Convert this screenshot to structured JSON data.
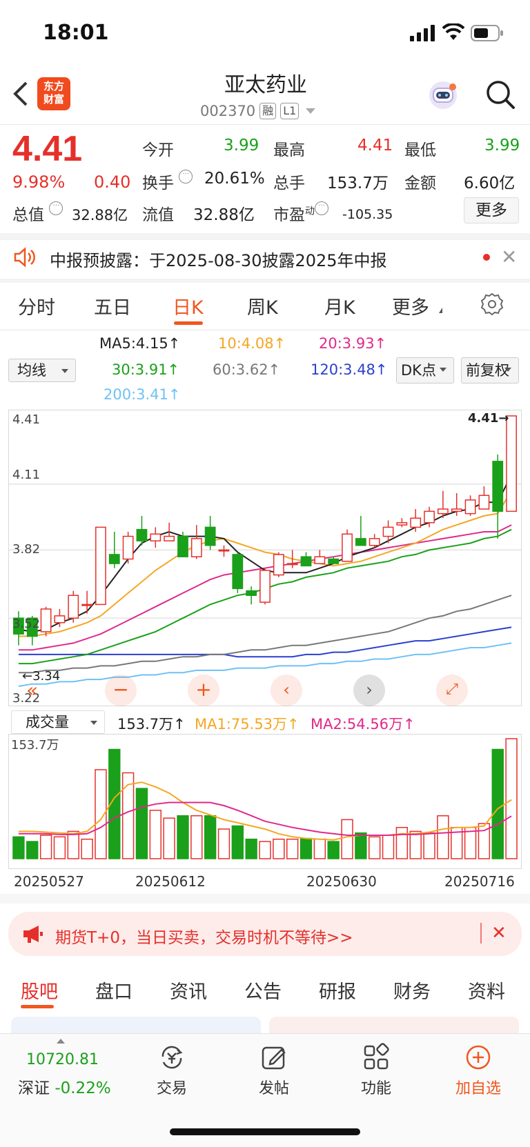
{
  "status": {
    "time": "18:01"
  },
  "header": {
    "name": "亚太药业",
    "code": "002370",
    "tag_rong": "融",
    "tag_l1": "L1",
    "logo_line1": "东方",
    "logo_line2": "财富"
  },
  "quote": {
    "price": "4.41",
    "pct": "9.98%",
    "change": "0.40",
    "open_label": "今开",
    "open": "3.99",
    "high_label": "最高",
    "high": "4.41",
    "low_label": "最低",
    "low": "3.99",
    "turnover_label": "换手",
    "turnover": "20.61%",
    "volume_label": "总手",
    "volume": "153.7万",
    "amount_label": "金额",
    "amount": "6.60亿",
    "mktcap_label": "总值",
    "mktcap": "32.88亿",
    "float_label": "流值",
    "float": "32.88亿",
    "pe_label": "市盈",
    "pe_sup": "动",
    "pe": "-105.35",
    "more": "更多"
  },
  "notice": {
    "text": "中报预披露：于2025-08-30披露2025年中报"
  },
  "ktabs": [
    "分时",
    "五日",
    "日K",
    "周K",
    "月K",
    "更多"
  ],
  "ma_legend": {
    "selector": "均线",
    "ma5": "MA5:4.15↑",
    "ma10": "10:4.08↑",
    "ma20": "20:3.93↑",
    "ma30": "30:3.91↑",
    "ma60": "60:3.62↑",
    "ma120": "120:3.48↑",
    "ma200": "200:3.41↑",
    "dk": "DK点",
    "fq": "前复权",
    "colors": {
      "ma5": "#222222",
      "ma10": "#f5a623",
      "ma20": "#e0298a",
      "ma30": "#1aa01a",
      "ma60": "#777777",
      "ma120": "#2a3fd0",
      "ma200": "#6ec1f5"
    }
  },
  "chart_axis": {
    "y_top": "4.41",
    "y2": "4.11",
    "y3": "3.82",
    "y4": "3.52",
    "y_bottom": "3.22",
    "last_price_tag": "4.41→",
    "low_tag": "←3.34"
  },
  "volume_legend": {
    "selector": "成交量",
    "vol": "153.7万↑",
    "ma1": "MA1:75.53万↑",
    "ma2": "MA2:54.56万↑",
    "max": "153.7万"
  },
  "dates": [
    "20250527",
    "20250612",
    "20250630",
    "20250716"
  ],
  "ad": {
    "text": "期货T+0，当日买卖，交易时机不等待>>"
  },
  "bottom_tabs": [
    "股吧",
    "盘口",
    "资讯",
    "公告",
    "研报",
    "财务",
    "资料"
  ],
  "index": {
    "value": "10720.81",
    "name": "深证",
    "pct": "-0.22%"
  },
  "nav": [
    "交易",
    "发帖",
    "功能",
    "加自选"
  ],
  "chart_data": {
    "type": "candlestick",
    "ylim": [
      3.22,
      4.41
    ],
    "up_color": "#e5302a",
    "down_color": "#1aa01a",
    "candles": [
      {
        "o": 3.52,
        "c": 3.45,
        "h": 3.55,
        "l": 3.4
      },
      {
        "o": 3.52,
        "c": 3.44,
        "h": 3.53,
        "l": 3.4
      },
      {
        "o": 3.46,
        "c": 3.56,
        "h": 3.57,
        "l": 3.44
      },
      {
        "o": 3.5,
        "c": 3.53,
        "h": 3.56,
        "l": 3.48
      },
      {
        "o": 3.52,
        "c": 3.62,
        "h": 3.64,
        "l": 3.5
      },
      {
        "o": 3.58,
        "c": 3.58,
        "h": 3.64,
        "l": 3.54
      },
      {
        "o": 3.58,
        "c": 3.92,
        "h": 3.92,
        "l": 3.58
      },
      {
        "o": 3.8,
        "c": 3.76,
        "h": 3.9,
        "l": 3.74
      },
      {
        "o": 3.78,
        "c": 3.88,
        "h": 3.9,
        "l": 3.76
      },
      {
        "o": 3.91,
        "c": 3.86,
        "h": 3.97,
        "l": 3.84
      },
      {
        "o": 3.86,
        "c": 3.89,
        "h": 3.92,
        "l": 3.83
      },
      {
        "o": 3.86,
        "c": 3.88,
        "h": 3.94,
        "l": 3.86
      },
      {
        "o": 3.88,
        "c": 3.79,
        "h": 3.9,
        "l": 3.79
      },
      {
        "o": 3.79,
        "c": 3.87,
        "h": 3.93,
        "l": 3.78
      },
      {
        "o": 3.92,
        "c": 3.84,
        "h": 3.97,
        "l": 3.82
      },
      {
        "o": 3.82,
        "c": 3.82,
        "h": 3.84,
        "l": 3.79
      },
      {
        "o": 3.8,
        "c": 3.65,
        "h": 3.81,
        "l": 3.63
      },
      {
        "o": 3.64,
        "c": 3.62,
        "h": 3.66,
        "l": 3.58
      },
      {
        "o": 3.59,
        "c": 3.73,
        "h": 3.74,
        "l": 3.58
      },
      {
        "o": 3.71,
        "c": 3.8,
        "h": 3.81,
        "l": 3.7
      },
      {
        "o": 3.76,
        "c": 3.76,
        "h": 3.82,
        "l": 3.74
      },
      {
        "o": 3.79,
        "c": 3.75,
        "h": 3.81,
        "l": 3.75
      },
      {
        "o": 3.76,
        "c": 3.79,
        "h": 3.82,
        "l": 3.76
      },
      {
        "o": 3.78,
        "c": 3.76,
        "h": 3.79,
        "l": 3.76
      },
      {
        "o": 3.77,
        "c": 3.89,
        "h": 3.91,
        "l": 3.77
      },
      {
        "o": 3.87,
        "c": 3.84,
        "h": 3.97,
        "l": 3.84
      },
      {
        "o": 3.84,
        "c": 3.87,
        "h": 3.89,
        "l": 3.83
      },
      {
        "o": 3.88,
        "c": 3.92,
        "h": 3.95,
        "l": 3.85
      },
      {
        "o": 3.93,
        "c": 3.94,
        "h": 3.96,
        "l": 3.92
      },
      {
        "o": 3.92,
        "c": 3.96,
        "h": 4.0,
        "l": 3.9
      },
      {
        "o": 3.94,
        "c": 3.99,
        "h": 4.01,
        "l": 3.92
      },
      {
        "o": 3.98,
        "c": 4.0,
        "h": 4.08,
        "l": 3.96
      },
      {
        "o": 3.99,
        "c": 4.0,
        "h": 4.07,
        "l": 3.97
      },
      {
        "o": 3.98,
        "c": 4.04,
        "h": 4.06,
        "l": 3.97
      },
      {
        "o": 4.0,
        "c": 4.06,
        "h": 4.1,
        "l": 4.0
      },
      {
        "o": 4.21,
        "c": 3.99,
        "h": 4.24,
        "l": 3.87
      },
      {
        "o": 3.99,
        "c": 4.41,
        "h": 4.41,
        "l": 3.99
      }
    ],
    "ma5": [
      3.47,
      3.46,
      3.47,
      3.5,
      3.52,
      3.55,
      3.62,
      3.7,
      3.78,
      3.85,
      3.88,
      3.9,
      3.88,
      3.88,
      3.88,
      3.87,
      3.81,
      3.77,
      3.73,
      3.72,
      3.72,
      3.72,
      3.74,
      3.76,
      3.79,
      3.81,
      3.83,
      3.86,
      3.89,
      3.92,
      3.94,
      3.97,
      3.99,
      4.0,
      4.03,
      4.03,
      4.15
    ],
    "ma10": [
      3.44,
      3.44,
      3.45,
      3.46,
      3.48,
      3.5,
      3.53,
      3.58,
      3.63,
      3.68,
      3.73,
      3.77,
      3.81,
      3.84,
      3.86,
      3.87,
      3.85,
      3.83,
      3.81,
      3.8,
      3.78,
      3.77,
      3.76,
      3.75,
      3.76,
      3.77,
      3.79,
      3.81,
      3.83,
      3.85,
      3.88,
      3.91,
      3.93,
      3.95,
      3.97,
      3.98,
      4.08
    ],
    "ma20": [
      3.38,
      3.38,
      3.39,
      3.4,
      3.41,
      3.43,
      3.45,
      3.48,
      3.51,
      3.54,
      3.57,
      3.6,
      3.63,
      3.66,
      3.69,
      3.71,
      3.72,
      3.73,
      3.74,
      3.75,
      3.76,
      3.77,
      3.78,
      3.79,
      3.8,
      3.81,
      3.82,
      3.83,
      3.84,
      3.85,
      3.86,
      3.87,
      3.88,
      3.89,
      3.9,
      3.9,
      3.93
    ],
    "ma30": [
      3.32,
      3.32,
      3.33,
      3.34,
      3.35,
      3.36,
      3.38,
      3.4,
      3.42,
      3.44,
      3.46,
      3.49,
      3.52,
      3.55,
      3.58,
      3.6,
      3.62,
      3.63,
      3.65,
      3.67,
      3.68,
      3.7,
      3.71,
      3.72,
      3.74,
      3.75,
      3.76,
      3.77,
      3.79,
      3.8,
      3.82,
      3.83,
      3.84,
      3.85,
      3.87,
      3.88,
      3.91
    ],
    "ma60": [
      3.28,
      3.28,
      3.29,
      3.29,
      3.3,
      3.3,
      3.31,
      3.31,
      3.32,
      3.33,
      3.33,
      3.34,
      3.35,
      3.35,
      3.36,
      3.36,
      3.37,
      3.38,
      3.38,
      3.39,
      3.4,
      3.4,
      3.41,
      3.42,
      3.43,
      3.44,
      3.45,
      3.46,
      3.48,
      3.5,
      3.52,
      3.53,
      3.55,
      3.56,
      3.58,
      3.6,
      3.62
    ],
    "ma120": [
      3.36,
      3.36,
      3.36,
      3.36,
      3.36,
      3.36,
      3.36,
      3.36,
      3.36,
      3.36,
      3.36,
      3.36,
      3.36,
      3.36,
      3.36,
      3.36,
      3.35,
      3.35,
      3.35,
      3.35,
      3.35,
      3.36,
      3.36,
      3.37,
      3.37,
      3.38,
      3.39,
      3.4,
      3.41,
      3.42,
      3.42,
      3.43,
      3.44,
      3.45,
      3.46,
      3.47,
      3.48
    ],
    "ma200": [
      3.22,
      3.23,
      3.23,
      3.24,
      3.24,
      3.25,
      3.25,
      3.26,
      3.26,
      3.27,
      3.27,
      3.28,
      3.28,
      3.29,
      3.29,
      3.29,
      3.3,
      3.3,
      3.3,
      3.31,
      3.31,
      3.31,
      3.32,
      3.32,
      3.33,
      3.33,
      3.34,
      3.34,
      3.35,
      3.36,
      3.36,
      3.37,
      3.38,
      3.39,
      3.39,
      3.4,
      3.41
    ],
    "volume_max": 153.7,
    "volumes": [
      28,
      22,
      30,
      28,
      35,
      25,
      114,
      140,
      110,
      90,
      62,
      52,
      55,
      55,
      55,
      38,
      42,
      25,
      22,
      25,
      25,
      26,
      25,
      22,
      50,
      33,
      28,
      30,
      40,
      35,
      33,
      55,
      40,
      40,
      45,
      140,
      153.7
    ],
    "vol_ma1": [
      35,
      35,
      34,
      33,
      32,
      35,
      50,
      78,
      95,
      98,
      92,
      84,
      72,
      62,
      56,
      50,
      46,
      42,
      38,
      32,
      28,
      26,
      25,
      24,
      28,
      30,
      30,
      30,
      32,
      32,
      34,
      38,
      40,
      40,
      42,
      64,
      75.53
    ],
    "vol_ma2": [
      32,
      32,
      32,
      31,
      31,
      32,
      40,
      52,
      60,
      66,
      70,
      72,
      72,
      72,
      72,
      68,
      62,
      55,
      48,
      44,
      40,
      37,
      34,
      32,
      30,
      30,
      30,
      30,
      31,
      31,
      32,
      33,
      34,
      35,
      36,
      44,
      54.56
    ]
  }
}
